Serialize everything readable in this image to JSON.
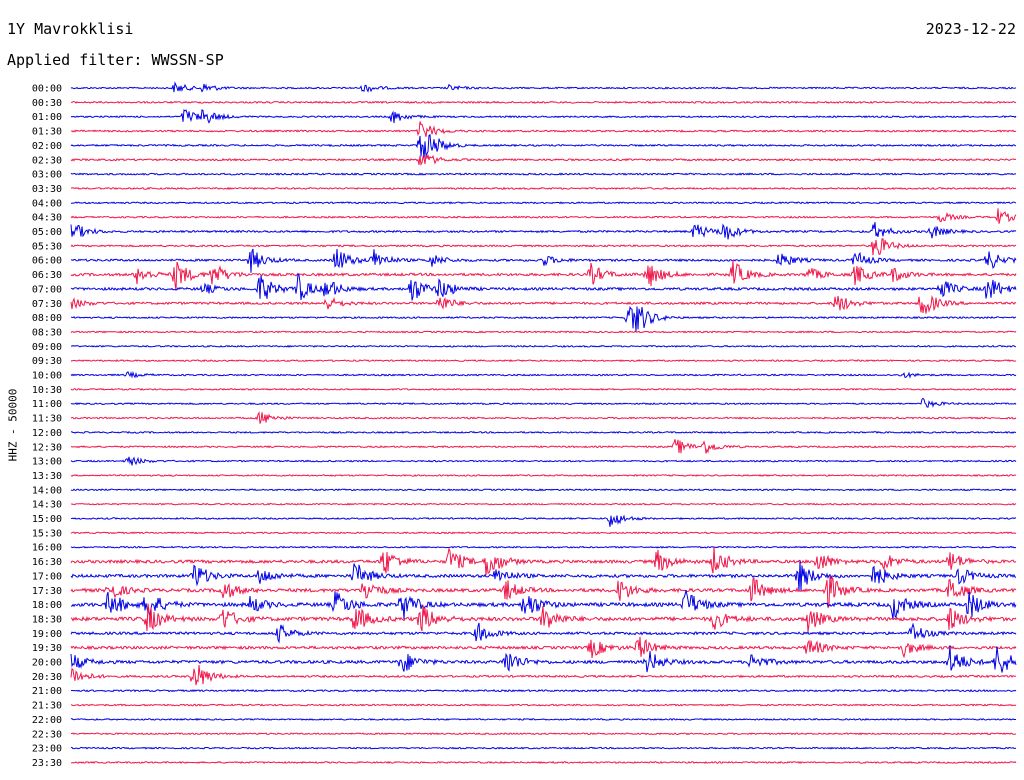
{
  "station": "1Y Mavrokklisi",
  "date": "2023-12-22",
  "filter_label": "Applied filter: WWSSN-SP",
  "channel_label": "HHZ - 50000",
  "colors": {
    "blue": "#0000e6",
    "red": "#f0164a"
  },
  "chart_data": {
    "type": "line",
    "title": "1Y Mavrokklisi",
    "subtitle": "Applied filter: WWSSN-SP",
    "ylabel": "HHZ - 50000",
    "xlabel": "",
    "grid": false,
    "legend": "none",
    "row_labels": [
      "00:00",
      "00:30",
      "01:00",
      "01:30",
      "02:00",
      "02:30",
      "03:00",
      "03:30",
      "04:00",
      "04:30",
      "05:00",
      "05:30",
      "06:00",
      "06:30",
      "07:00",
      "07:30",
      "08:00",
      "08:30",
      "09:00",
      "09:30",
      "10:00",
      "10:30",
      "11:00",
      "11:30",
      "12:00",
      "12:30",
      "13:00",
      "13:30",
      "14:00",
      "14:30",
      "15:00",
      "15:30",
      "16:00",
      "16:30",
      "17:00",
      "17:30",
      "18:00",
      "18:30",
      "19:00",
      "19:30",
      "20:00",
      "20:30",
      "21:00",
      "21:30",
      "22:00",
      "22:30",
      "23:00",
      "23:30"
    ],
    "row_colors": [
      "blue",
      "red"
    ],
    "noise_level": [
      0.06,
      0.1,
      0.06,
      0.1,
      0.1,
      0.13,
      0.09,
      0.08,
      0.07,
      0.08,
      0.16,
      0.1,
      0.2,
      0.3,
      0.3,
      0.22,
      0.08,
      0.05,
      0.05,
      0.05,
      0.05,
      0.04,
      0.05,
      0.06,
      0.06,
      0.06,
      0.05,
      0.04,
      0.05,
      0.04,
      0.05,
      0.04,
      0.04,
      0.4,
      0.4,
      0.45,
      0.55,
      0.55,
      0.3,
      0.35,
      0.4,
      0.15,
      0.1,
      0.06,
      0.04,
      0.06,
      0.04,
      0.06
    ],
    "events": [
      [
        [
          0.11,
          0.3
        ],
        [
          0.14,
          0.25
        ],
        [
          0.31,
          0.25
        ],
        [
          0.4,
          0.15
        ]
      ],
      [],
      [
        [
          0.12,
          0.5
        ],
        [
          0.14,
          0.4
        ],
        [
          0.34,
          0.4
        ]
      ],
      [
        [
          0.37,
          0.6
        ]
      ],
      [
        [
          0.37,
          1.0
        ],
        [
          0.38,
          0.3
        ]
      ],
      [
        [
          0.37,
          0.5
        ]
      ],
      [],
      [],
      [],
      [
        [
          0.92,
          0.3
        ],
        [
          0.98,
          0.5
        ]
      ],
      [
        [
          0.0,
          0.6
        ],
        [
          0.66,
          0.5
        ],
        [
          0.69,
          0.6
        ],
        [
          0.85,
          0.5
        ],
        [
          0.91,
          0.4
        ]
      ],
      [
        [
          0.85,
          0.8
        ]
      ],
      [
        [
          0.19,
          0.7
        ],
        [
          0.28,
          0.8
        ],
        [
          0.32,
          0.6
        ],
        [
          0.38,
          0.4
        ],
        [
          0.5,
          0.3
        ],
        [
          0.75,
          0.5
        ],
        [
          0.83,
          0.5
        ],
        [
          0.97,
          0.6
        ]
      ],
      [
        [
          0.07,
          0.5
        ],
        [
          0.11,
          0.9
        ],
        [
          0.15,
          0.7
        ],
        [
          0.55,
          0.6
        ],
        [
          0.61,
          0.8
        ],
        [
          0.7,
          0.8
        ],
        [
          0.78,
          0.4
        ],
        [
          0.83,
          0.6
        ],
        [
          0.87,
          0.4
        ]
      ],
      [
        [
          0.14,
          0.3
        ],
        [
          0.2,
          0.9
        ],
        [
          0.24,
          0.8
        ],
        [
          0.27,
          0.6
        ],
        [
          0.36,
          0.8
        ],
        [
          0.39,
          0.6
        ],
        [
          0.92,
          0.6
        ],
        [
          0.97,
          0.8
        ]
      ],
      [
        [
          0.0,
          0.3
        ],
        [
          0.27,
          0.4
        ],
        [
          0.39,
          0.5
        ],
        [
          0.81,
          0.6
        ],
        [
          0.9,
          0.9
        ]
      ],
      [
        [
          0.59,
          1.0
        ],
        [
          0.6,
          0.5
        ]
      ],
      [],
      [],
      [],
      [
        [
          0.06,
          0.15
        ],
        [
          0.88,
          0.15
        ]
      ],
      [],
      [
        [
          0.9,
          0.3
        ]
      ],
      [
        [
          0.2,
          0.4
        ]
      ],
      [],
      [
        [
          0.64,
          0.5
        ],
        [
          0.67,
          0.4
        ]
      ],
      [
        [
          0.06,
          0.3
        ]
      ],
      [],
      [],
      [],
      [
        [
          0.57,
          0.5
        ]
      ],
      [],
      [],
      [
        [
          0.33,
          0.9
        ],
        [
          0.4,
          0.8
        ],
        [
          0.44,
          1.0
        ],
        [
          0.62,
          0.7
        ],
        [
          0.68,
          0.8
        ],
        [
          0.79,
          0.6
        ],
        [
          0.86,
          0.5
        ],
        [
          0.93,
          0.6
        ]
      ],
      [
        [
          0.13,
          0.8
        ],
        [
          0.2,
          0.5
        ],
        [
          0.3,
          0.8
        ],
        [
          0.45,
          0.5
        ],
        [
          0.77,
          0.9
        ],
        [
          0.85,
          0.7
        ],
        [
          0.94,
          0.5
        ]
      ],
      [
        [
          0.04,
          0.6
        ],
        [
          0.16,
          0.6
        ],
        [
          0.31,
          0.7
        ],
        [
          0.46,
          0.6
        ],
        [
          0.58,
          0.7
        ],
        [
          0.72,
          0.8
        ],
        [
          0.8,
          1.0
        ],
        [
          0.93,
          0.8
        ]
      ],
      [
        [
          0.04,
          0.8
        ],
        [
          0.08,
          0.9
        ],
        [
          0.19,
          0.5
        ],
        [
          0.28,
          0.8
        ],
        [
          0.35,
          0.9
        ],
        [
          0.48,
          0.9
        ],
        [
          0.65,
          0.9
        ],
        [
          0.87,
          0.8
        ],
        [
          0.95,
          0.8
        ]
      ],
      [
        [
          0.08,
          0.9
        ],
        [
          0.16,
          0.7
        ],
        [
          0.3,
          0.8
        ],
        [
          0.37,
          0.9
        ],
        [
          0.5,
          0.8
        ],
        [
          0.68,
          0.6
        ],
        [
          0.78,
          0.7
        ],
        [
          0.93,
          0.7
        ]
      ],
      [
        [
          0.22,
          0.5
        ],
        [
          0.43,
          0.6
        ],
        [
          0.89,
          0.6
        ]
      ],
      [
        [
          0.55,
          0.6
        ],
        [
          0.6,
          0.7
        ],
        [
          0.78,
          0.6
        ],
        [
          0.88,
          0.5
        ]
      ],
      [
        [
          0.0,
          0.5
        ],
        [
          0.35,
          0.7
        ],
        [
          0.46,
          0.8
        ],
        [
          0.61,
          0.7
        ],
        [
          0.72,
          0.5
        ],
        [
          0.93,
          0.9
        ],
        [
          0.98,
          1.0
        ]
      ],
      [
        [
          0.0,
          0.6
        ],
        [
          0.13,
          1.0
        ]
      ],
      [],
      [],
      [],
      [],
      [],
      []
    ]
  }
}
